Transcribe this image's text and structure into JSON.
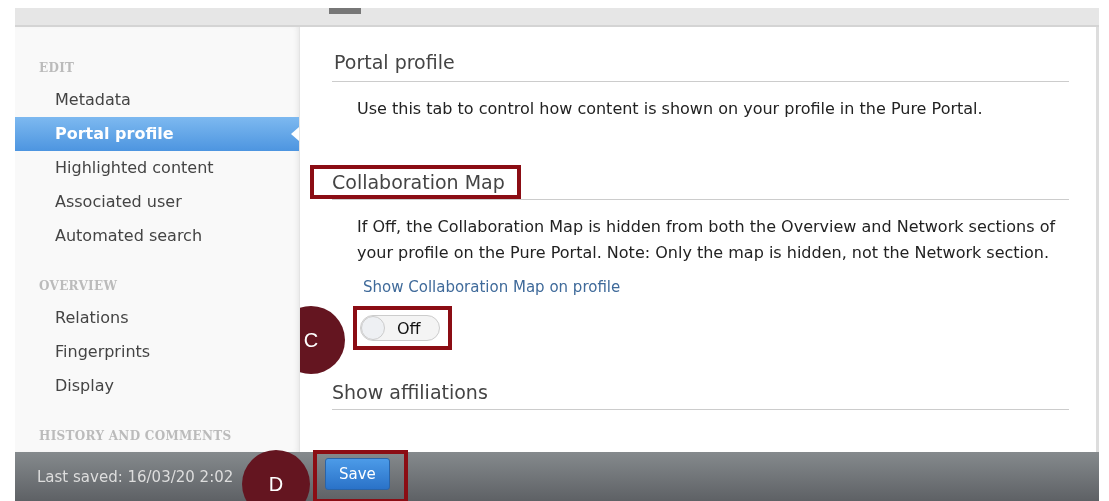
{
  "sidebar": {
    "sections": [
      {
        "heading": "EDIT",
        "items": [
          {
            "label": "Metadata",
            "selected": false
          },
          {
            "label": "Portal profile",
            "selected": true
          },
          {
            "label": "Highlighted content",
            "selected": false
          },
          {
            "label": "Associated user",
            "selected": false
          },
          {
            "label": "Automated search",
            "selected": false
          }
        ]
      },
      {
        "heading": "OVERVIEW",
        "items": [
          {
            "label": "Relations",
            "selected": false
          },
          {
            "label": "Fingerprints",
            "selected": false
          },
          {
            "label": "Display",
            "selected": false
          }
        ]
      },
      {
        "heading": "HISTORY AND COMMENTS"
      }
    ]
  },
  "content": {
    "title": "Portal profile",
    "intro": "Use this tab to control how content is shown on your profile in the Pure Portal.",
    "sections": [
      {
        "heading": "Collaboration Map",
        "highlighted": true,
        "description": "If Off, the Collaboration Map is hidden from both the Overview and Network sections of your profile on the Pure Portal. Note: Only the map is hidden, not the Network section.",
        "toggle": {
          "label": "Show Collaboration Map on profile",
          "on": false,
          "state_text": "Off",
          "annotation_outline": true,
          "callout": "C"
        }
      },
      {
        "heading": "Show affiliations",
        "highlighted": false
      }
    ]
  },
  "footer": {
    "last_saved": "Last saved: 16/03/20 2:02",
    "save_button": {
      "label": "Save",
      "highlighted": true,
      "callout": "D"
    }
  }
}
